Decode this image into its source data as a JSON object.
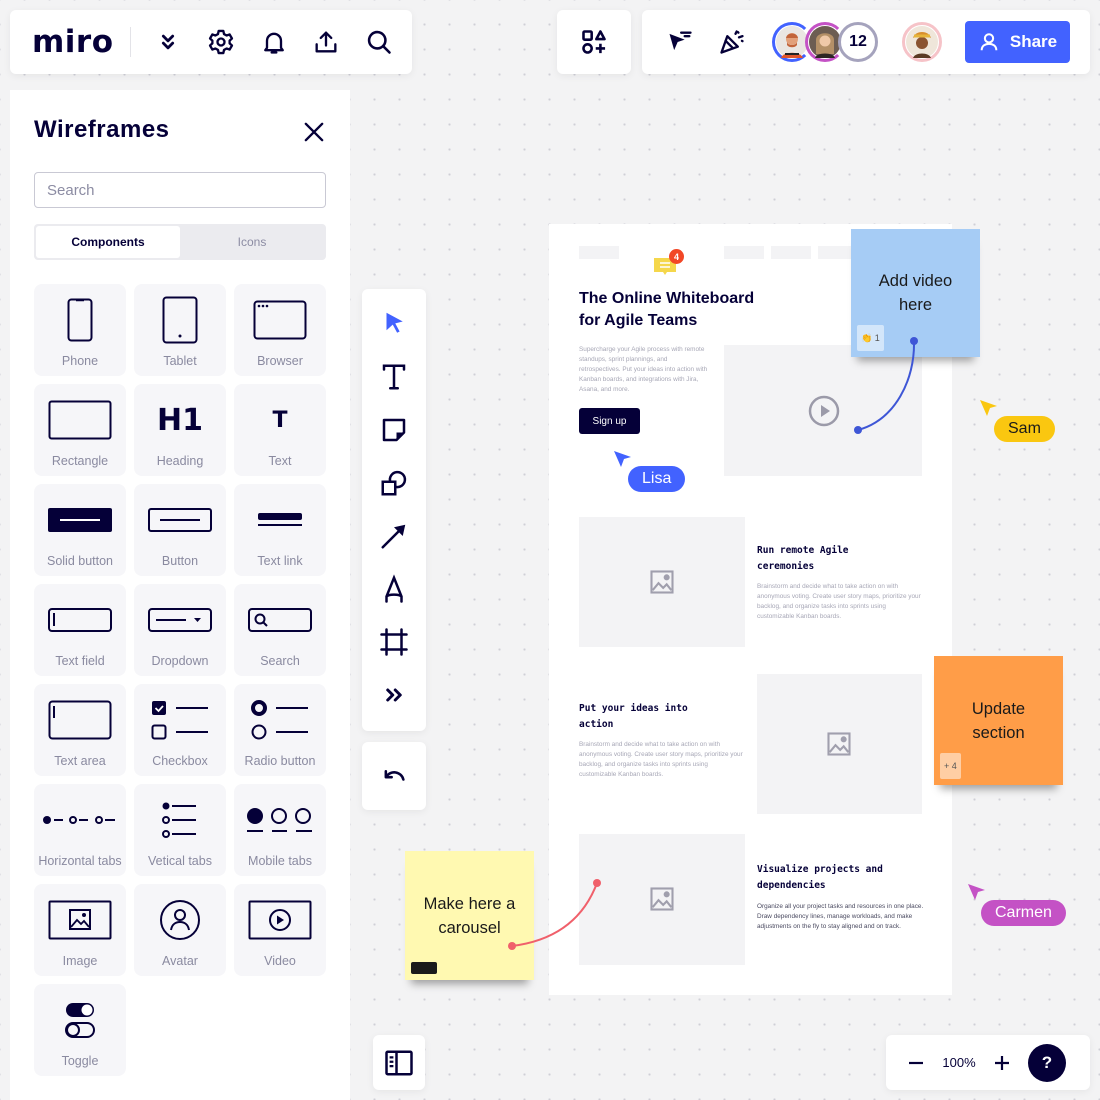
{
  "app": {
    "logo": "miro"
  },
  "topbar": {
    "left_icons": [
      "chevrons-down-icon",
      "gear-icon",
      "bell-icon",
      "upload-icon",
      "search-icon"
    ],
    "right_icons": [
      "shapes-icon",
      "cursor-filter-icon",
      "celebrate-icon"
    ],
    "collaborators_more_count": "12",
    "share_label": "Share",
    "colors": {
      "share_bg": "#4262ff"
    }
  },
  "sidebar": {
    "title": "Wireframes",
    "search_placeholder": "Search",
    "search_value": "",
    "tabs": [
      {
        "label": "Components",
        "active": true
      },
      {
        "label": "Icons",
        "active": false
      }
    ],
    "components": [
      {
        "label": "Phone",
        "icon": "phone-icon"
      },
      {
        "label": "Tablet",
        "icon": "tablet-icon"
      },
      {
        "label": "Browser",
        "icon": "browser-icon"
      },
      {
        "label": "Rectangle",
        "icon": "rectangle-icon"
      },
      {
        "label": "Heading",
        "icon": "heading-icon",
        "glyph": "H1"
      },
      {
        "label": "Text",
        "icon": "text-icon",
        "glyph": "T"
      },
      {
        "label": "Solid button",
        "icon": "solid-button-icon"
      },
      {
        "label": "Button",
        "icon": "button-icon"
      },
      {
        "label": "Text link",
        "icon": "text-link-icon"
      },
      {
        "label": "Text field",
        "icon": "text-field-icon"
      },
      {
        "label": "Dropdown",
        "icon": "dropdown-icon"
      },
      {
        "label": "Search",
        "icon": "search-field-icon"
      },
      {
        "label": "Text area",
        "icon": "text-area-icon"
      },
      {
        "label": "Checkbox",
        "icon": "checkbox-icon"
      },
      {
        "label": "Radio button",
        "icon": "radio-button-icon"
      },
      {
        "label": "Horizontal tabs",
        "icon": "horizontal-tabs-icon"
      },
      {
        "label": "Vetical tabs",
        "icon": "vertical-tabs-icon"
      },
      {
        "label": "Mobile tabs",
        "icon": "mobile-tabs-icon"
      },
      {
        "label": "Image",
        "icon": "image-icon"
      },
      {
        "label": "Avatar",
        "icon": "avatar-icon"
      },
      {
        "label": "Video",
        "icon": "video-icon"
      },
      {
        "label": "Toggle",
        "icon": "toggle-icon"
      }
    ]
  },
  "toolbar": {
    "tools": [
      "select-tool",
      "text-tool",
      "sticky-note-tool",
      "shapes-tool",
      "arrow-tool",
      "pen-tool",
      "frame-tool",
      "more-tools"
    ],
    "undo": "undo"
  },
  "board": {
    "comment_badge": "4",
    "hero": {
      "title": "The Online Whiteboard for Agile Teams",
      "description": "Supercharge your Agile process with remote standups, sprint plannings, and retrospectives. Put your ideas into action with Kanban boards, and integrations with Jira, Asana, and more.",
      "cta": "Sign up"
    },
    "sections": [
      {
        "title": "Run remote Agile ceremonies",
        "description": "Brainstorm and decide what to take action on with anonymous voting. Create user story maps, prioritize your backlog, and organize tasks into sprints using customizable Kanban boards."
      },
      {
        "title": "Put your ideas into action",
        "description": "Brainstorm and decide what to take action on with anonymous voting. Create user story maps, prioritize your backlog, and organize tasks into sprints using customizable Kanban boards."
      },
      {
        "title": "Visualize projects and dependencies",
        "description": "Organize all your project tasks and resources in one place. Draw dependency lines, manage workloads, and make adjustments on the fly to stay aligned and on track."
      }
    ]
  },
  "stickies": [
    {
      "text": "Add video here",
      "color": "#a6ccf5",
      "reaction": "👏 1"
    },
    {
      "text": "Update section",
      "color": "#ff9d48",
      "reaction": "+ 4"
    },
    {
      "text": "Make here a carousel",
      "color": "#fff9b1",
      "reaction": ""
    }
  ],
  "cursors": [
    {
      "name": "Lisa",
      "color": "#4262ff",
      "text_color": "#ffffff"
    },
    {
      "name": "Sam",
      "color": "#fac710",
      "text_color": "#1a1a1a"
    },
    {
      "name": "Carmen",
      "color": "#c452c5",
      "text_color": "#ffffff"
    }
  ],
  "bottom": {
    "zoom_level": "100%",
    "zoom_out": "−",
    "zoom_in": "+",
    "help": "?"
  }
}
